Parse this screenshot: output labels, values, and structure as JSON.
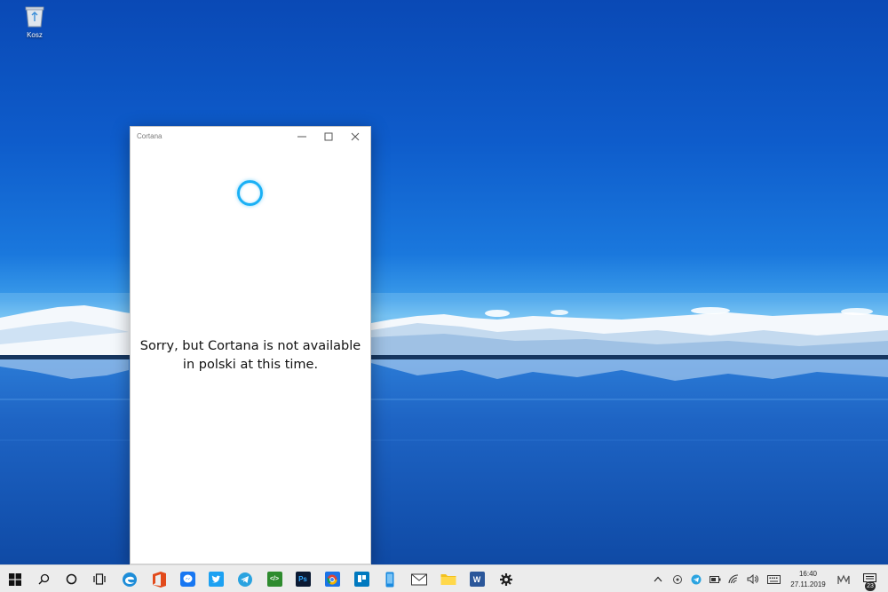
{
  "desktop": {
    "icons": [
      {
        "label": "Kosz",
        "icon": "recycle-bin-icon"
      }
    ]
  },
  "window": {
    "title": "Cortana",
    "controls": [
      "minimize",
      "maximize",
      "close"
    ],
    "message_line1": "Sorry, but Cortana is not available",
    "message_line2": "in polski at this time.",
    "ring_color": "#1ab0f5"
  },
  "taskbar": {
    "background": "#ececec",
    "start": "windows-logo-icon",
    "search": "search-icon",
    "cortana": "cortana-circle-icon",
    "task_view": "task-view-icon",
    "apps": [
      {
        "name": "edge",
        "color": "#1e8dd8",
        "glyph": "e"
      },
      {
        "name": "office",
        "color": "#e24a1b",
        "glyph": ""
      },
      {
        "name": "messenger",
        "color": "#1877f2",
        "glyph": ""
      },
      {
        "name": "twitter",
        "color": "#1da1f2",
        "glyph": ""
      },
      {
        "name": "telegram",
        "color": "#2aa3e0",
        "glyph": ""
      },
      {
        "name": "code-editor",
        "color": "#2e8b2e",
        "glyph": "</>"
      },
      {
        "name": "photoshop",
        "color": "#0b1a33",
        "glyph": "Ps"
      },
      {
        "name": "chrome",
        "color": "#1a73e8",
        "glyph": ""
      },
      {
        "name": "trello",
        "color": "#0079bf",
        "glyph": ""
      },
      {
        "name": "phone",
        "color": "#1b8be0",
        "glyph": ""
      },
      {
        "name": "mail",
        "color": "#3a3a3a",
        "glyph": ""
      },
      {
        "name": "file-explorer",
        "color": "#f3c11e",
        "glyph": ""
      },
      {
        "name": "word",
        "color": "#2b579a",
        "glyph": "W"
      },
      {
        "name": "settings",
        "color": "#333333",
        "glyph": ""
      }
    ],
    "time": "16:40",
    "date": "27.11.2019",
    "notifications": "23"
  }
}
